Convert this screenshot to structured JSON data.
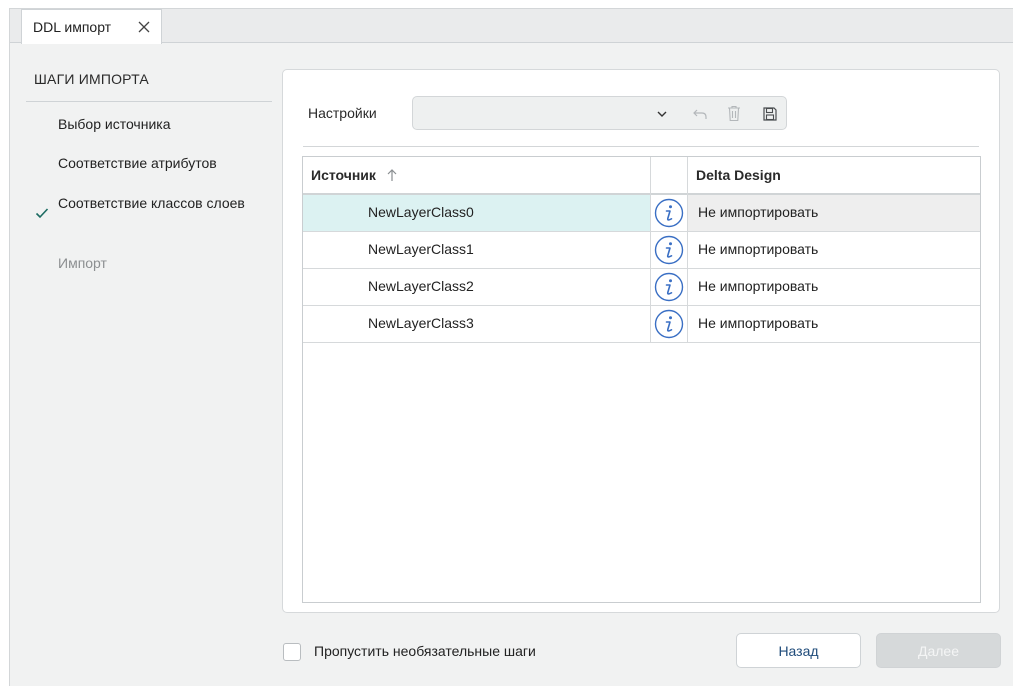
{
  "tab": {
    "title": "DDL импорт"
  },
  "steps": {
    "title": "ШАГИ ИМПОРТА",
    "items": [
      {
        "label": "Выбор источника",
        "state": "normal"
      },
      {
        "label": "Соответствие атрибутов",
        "state": "normal"
      },
      {
        "label": "Соответствие классов слоев",
        "state": "current"
      },
      {
        "label": "Импорт",
        "state": "disabled"
      }
    ]
  },
  "settings": {
    "label": "Настройки",
    "value": ""
  },
  "table": {
    "columns": {
      "source": "Источник",
      "target": "Delta Design"
    },
    "sort": "ascending",
    "rows": [
      {
        "source": "NewLayerClass0",
        "target": "Не импортировать",
        "selected": true
      },
      {
        "source": "NewLayerClass1",
        "target": "Не импортировать",
        "selected": false
      },
      {
        "source": "NewLayerClass2",
        "target": "Не импортировать",
        "selected": false
      },
      {
        "source": "NewLayerClass3",
        "target": "Не импортировать",
        "selected": false
      }
    ]
  },
  "footer": {
    "skip_label": "Пропустить необязательные шаги",
    "skip_checked": false,
    "back_label": "Назад",
    "next_label": "Далее"
  },
  "colors": {
    "accent_text": "#1f4b7a",
    "check_green": "#1c6b62",
    "info_blue": "#3a6fc4",
    "selected_row": "#dcf2f2"
  }
}
